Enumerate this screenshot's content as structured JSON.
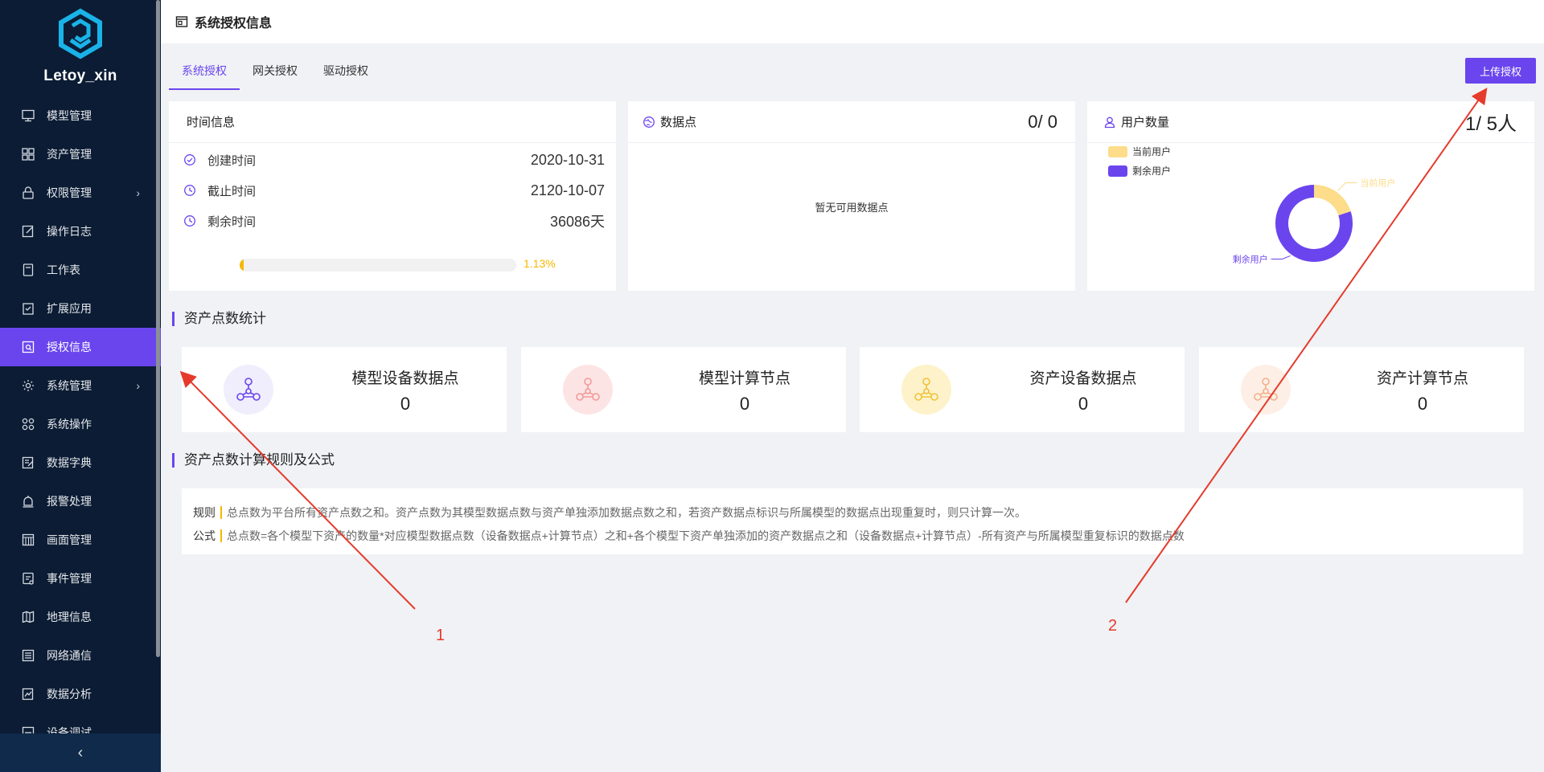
{
  "app": {
    "name": "Letoy_xin",
    "logo_icon": "hexagon-logo-icon"
  },
  "sidebar": {
    "items": [
      {
        "label": "模型管理",
        "icon": "model-icon",
        "active": false,
        "has_children": false
      },
      {
        "label": "资产管理",
        "icon": "grid-icon",
        "active": false,
        "has_children": false
      },
      {
        "label": "权限管理",
        "icon": "lock-icon",
        "active": false,
        "has_children": true
      },
      {
        "label": "操作日志",
        "icon": "edit-log-icon",
        "active": false,
        "has_children": false
      },
      {
        "label": "工作表",
        "icon": "worksheet-icon",
        "active": false,
        "has_children": false
      },
      {
        "label": "扩展应用",
        "icon": "clipboard-check-icon",
        "active": false,
        "has_children": false
      },
      {
        "label": "授权信息",
        "icon": "license-icon",
        "active": true,
        "has_children": false
      },
      {
        "label": "系统管理",
        "icon": "gear-icon",
        "active": false,
        "has_children": true
      },
      {
        "label": "系统操作",
        "icon": "dots-grid-icon",
        "active": false,
        "has_children": false
      },
      {
        "label": "数据字典",
        "icon": "dictionary-icon",
        "active": false,
        "has_children": false
      },
      {
        "label": "报警处理",
        "icon": "alarm-icon",
        "active": false,
        "has_children": false
      },
      {
        "label": "画面管理",
        "icon": "screen-icon",
        "active": false,
        "has_children": false
      },
      {
        "label": "事件管理",
        "icon": "event-icon",
        "active": false,
        "has_children": false
      },
      {
        "label": "地理信息",
        "icon": "map-icon",
        "active": false,
        "has_children": false
      },
      {
        "label": "网络通信",
        "icon": "network-icon",
        "active": false,
        "has_children": false
      },
      {
        "label": "数据分析",
        "icon": "analysis-icon",
        "active": false,
        "has_children": false
      },
      {
        "label": "设备调试",
        "icon": "debug-icon",
        "active": false,
        "has_children": false
      }
    ],
    "collapse_glyph": "‹",
    "arrow_glyph": "›"
  },
  "header": {
    "title": "系统授权信息",
    "icon": "license-window-icon"
  },
  "tabs": [
    {
      "label": "系统授权",
      "active": true
    },
    {
      "label": "网关授权",
      "active": false
    },
    {
      "label": "驱动授权",
      "active": false
    }
  ],
  "upload_button": "上传授权",
  "time_card": {
    "title": "时间信息",
    "rows": [
      {
        "label": "创建时间",
        "value": "2020-10-31",
        "icon": "check-circle-icon"
      },
      {
        "label": "截止时间",
        "value": "2120-10-07",
        "icon": "clock-icon"
      },
      {
        "label": "剩余时间",
        "value": "36086天",
        "icon": "clock-icon"
      }
    ],
    "progress_percent": 1.13,
    "progress_text": "1.13%"
  },
  "datapoint_card": {
    "title": "数据点",
    "value": "0/ 0",
    "empty_text": "暂无可用数据点",
    "icon": "globe-icon"
  },
  "user_card": {
    "title": "用户数量",
    "value": "1/ 5人",
    "icon": "user-icon",
    "legend": [
      {
        "label": "当前用户",
        "color": "#fddc8a"
      },
      {
        "label": "剩余用户",
        "color": "#6a45ee"
      }
    ],
    "chart_data": {
      "type": "pie",
      "categories": [
        "当前用户",
        "剩余用户"
      ],
      "values": [
        1,
        4
      ],
      "colors": [
        "#fddc8a",
        "#6a45ee"
      ],
      "donut": true
    }
  },
  "asset_section": {
    "title": "资产点数统计"
  },
  "stats": [
    {
      "title": "模型设备数据点",
      "value": "0",
      "icon": "nodes-icon",
      "color": "#6a45ee",
      "bg": "#f0eefc"
    },
    {
      "title": "模型计算节点",
      "value": "0",
      "icon": "nodes-icon",
      "color": "#f19a9a",
      "bg": "#fde4e4"
    },
    {
      "title": "资产设备数据点",
      "value": "0",
      "icon": "nodes-icon",
      "color": "#f0c23c",
      "bg": "#fdf2c9"
    },
    {
      "title": "资产计算节点",
      "value": "0",
      "icon": "nodes-icon",
      "color": "#f4b08a",
      "bg": "#fdefe6"
    }
  ],
  "rules_section": {
    "title": "资产点数计算规则及公式",
    "rule_label": "规则",
    "rule_text": "总点数为平台所有资产点数之和。资产点数为其模型数据点数与资产单独添加数据点数之和，若资产数据点标识与所属模型的数据点出现重复时，则只计算一次。",
    "formula_label": "公式",
    "formula_text": "总点数=各个模型下资产的数量*对应模型数据点数（设备数据点+计算节点）之和+各个模型下资产单独添加的资产数据点之和（设备数据点+计算节点）-所有资产与所属模型重复标识的数据点数"
  },
  "annotations": [
    {
      "label": "1",
      "color": "#e53b2c"
    },
    {
      "label": "2",
      "color": "#e53b2c"
    }
  ]
}
